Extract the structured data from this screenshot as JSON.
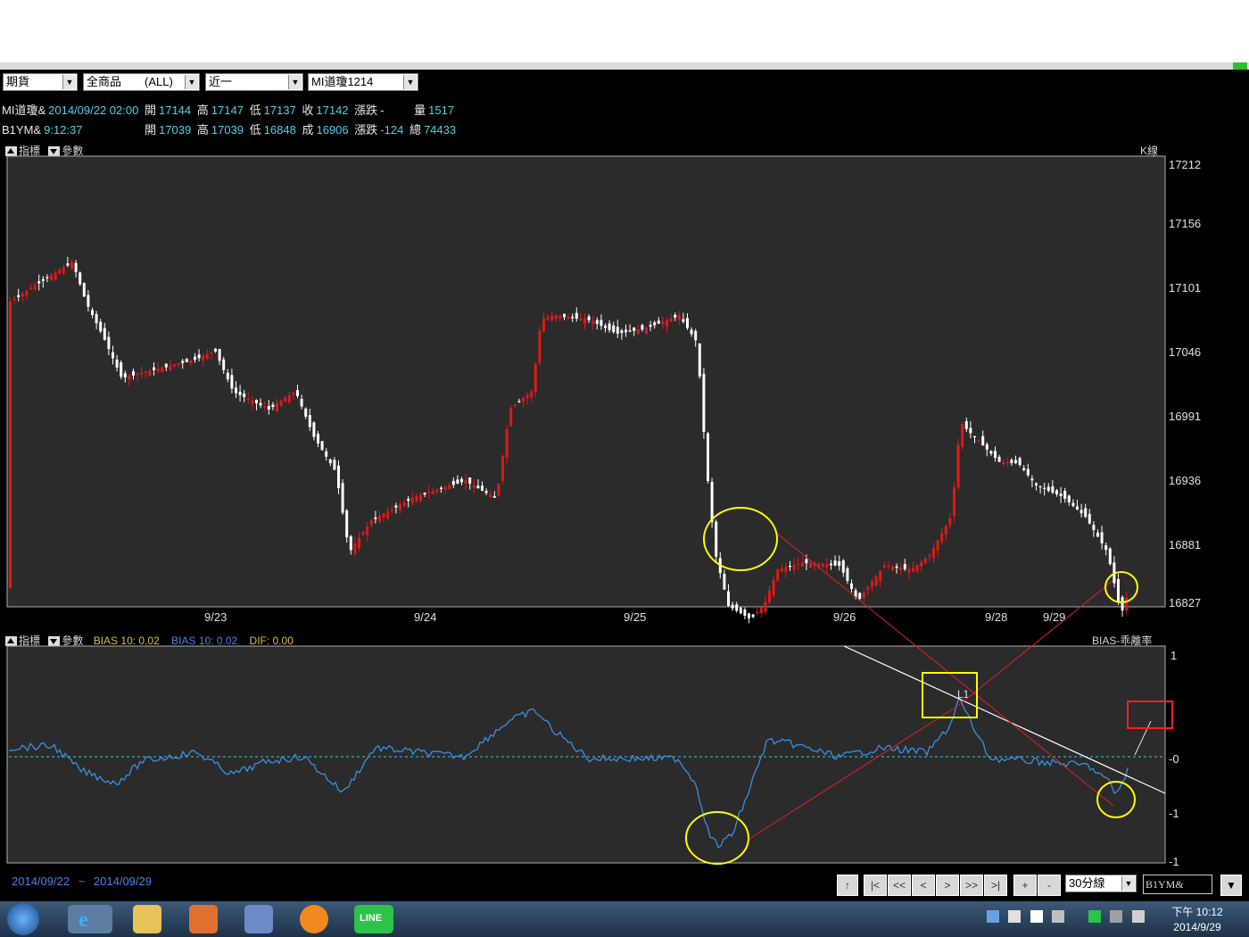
{
  "toolbar": {
    "combo1": "期貨",
    "combo2": "全商品　　(ALL)",
    "combo3": "近一",
    "combo4": "MI道瓊1214"
  },
  "quote1": {
    "name": "MI道瓊&",
    "datetime": "2014/09/22 02:00",
    "open_lbl": "開",
    "open": "17144",
    "high_lbl": "高",
    "high": "17147",
    "low_lbl": "低",
    "low": "17137",
    "close_lbl": "收",
    "close": "17142",
    "chg_lbl": "漲跌",
    "chg": "-",
    "vol_lbl": "量",
    "vol": "1517"
  },
  "quote2": {
    "name": "B1YM&",
    "time": "9:12:37",
    "open_lbl": "開",
    "open": "17039",
    "high_lbl": "高",
    "high": "17039",
    "low_lbl": "低",
    "low": "16848",
    "deal_lbl": "成",
    "deal": "16906",
    "chg_lbl": "漲跌",
    "chg": "-124",
    "total_lbl": "總",
    "total": "74433"
  },
  "upper_panel": {
    "indicator_btn": "指標",
    "param_btn": "參數",
    "title": "K線",
    "y_ticks": [
      "17212",
      "17156",
      "17101",
      "17046",
      "16991",
      "16936",
      "16881",
      "16827"
    ],
    "x_ticks": [
      "9/23",
      "9/24",
      "9/25",
      "9/26",
      "9/28",
      "9/29"
    ]
  },
  "lower_panel": {
    "indicator_btn": "指標",
    "param_btn": "參數",
    "bias1": "BIAS 10:  0.02",
    "bias2": "BIAS 10:  0.02",
    "dif": "DIF:    0.00",
    "title": "BIAS-乖離率",
    "y_ticks": [
      "1",
      "0",
      "-0",
      "-1",
      "-1"
    ],
    "line_label": "L1"
  },
  "bottom": {
    "range_start": "2014/09/22",
    "range_sep": "~",
    "range_end": "2014/09/29",
    "buttons": [
      "↑",
      "|<",
      "<<",
      "<",
      ">",
      ">>",
      ">|",
      "+",
      "-"
    ],
    "interval": "30分線",
    "symbol": "B1YM&"
  },
  "taskbar": {
    "time": "下午 10:12",
    "date": "2014/9/29"
  },
  "colors": {
    "up_candle": "#e01818",
    "down_candle": "#ffffff",
    "bias_line": "#3a8fe0",
    "annotation": "#ffff00",
    "trend_line": "#e02020",
    "box_red": "#ff2020"
  }
}
